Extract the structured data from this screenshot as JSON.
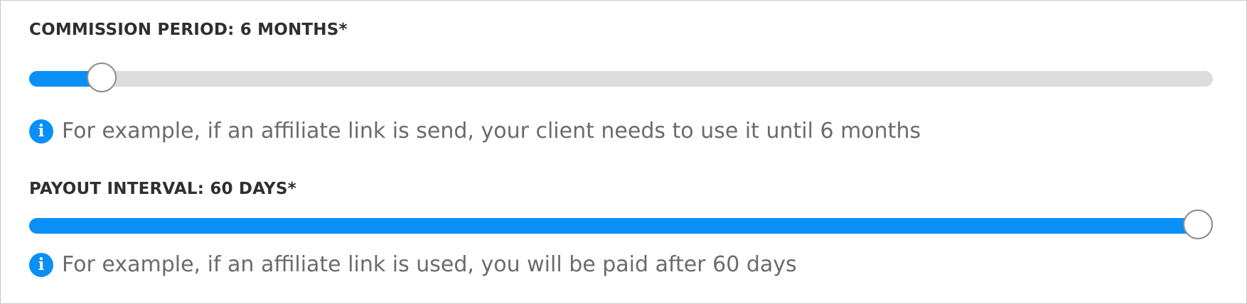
{
  "colors": {
    "accent": "#0a8ff6",
    "track": "#dcdcdc",
    "label": "#2f2f2f",
    "helper_text": "#6b6b6b",
    "thumb_border": "#8a8a8a"
  },
  "commission_period": {
    "label": "COMMISSION PERIOD: 6 MONTHS*",
    "slider_value_fraction": 0.05,
    "info_icon": "info-icon",
    "info_text": "For example, if an affiliate link is send, your client needs to use it until 6 months"
  },
  "payout_interval": {
    "label": "PAYOUT INTERVAL: 60 DAYS*",
    "slider_value_fraction": 1.0,
    "info_icon": "info-icon",
    "info_text": "For example, if an affiliate link is used, you will be paid after 60 days"
  }
}
